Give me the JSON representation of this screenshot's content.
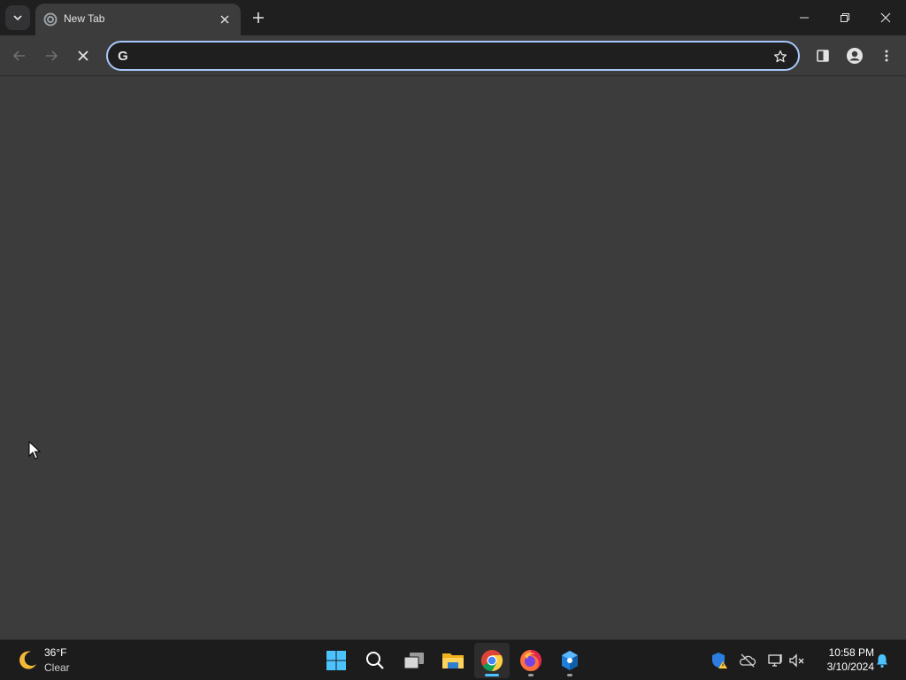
{
  "browser": {
    "tab": {
      "title": "New Tab"
    },
    "omnibox": {
      "value": "",
      "placeholder": ""
    }
  },
  "taskbar": {
    "weather": {
      "temperature": "36°F",
      "condition": "Clear"
    },
    "apps": [
      {
        "name": "start",
        "active": false
      },
      {
        "name": "search",
        "active": false
      },
      {
        "name": "task-view",
        "active": false
      },
      {
        "name": "file-explorer",
        "active": false
      },
      {
        "name": "chrome",
        "active": true
      },
      {
        "name": "firefox",
        "active": false
      },
      {
        "name": "app",
        "active": false
      }
    ],
    "clock": {
      "time": "10:58 PM",
      "date": "3/10/2024"
    }
  },
  "colors": {
    "accent": "#a8c7fa",
    "content_bg": "#3c3c3c",
    "taskbar_bg": "#1c1c1c",
    "active_indicator": "#4cc2ff"
  }
}
